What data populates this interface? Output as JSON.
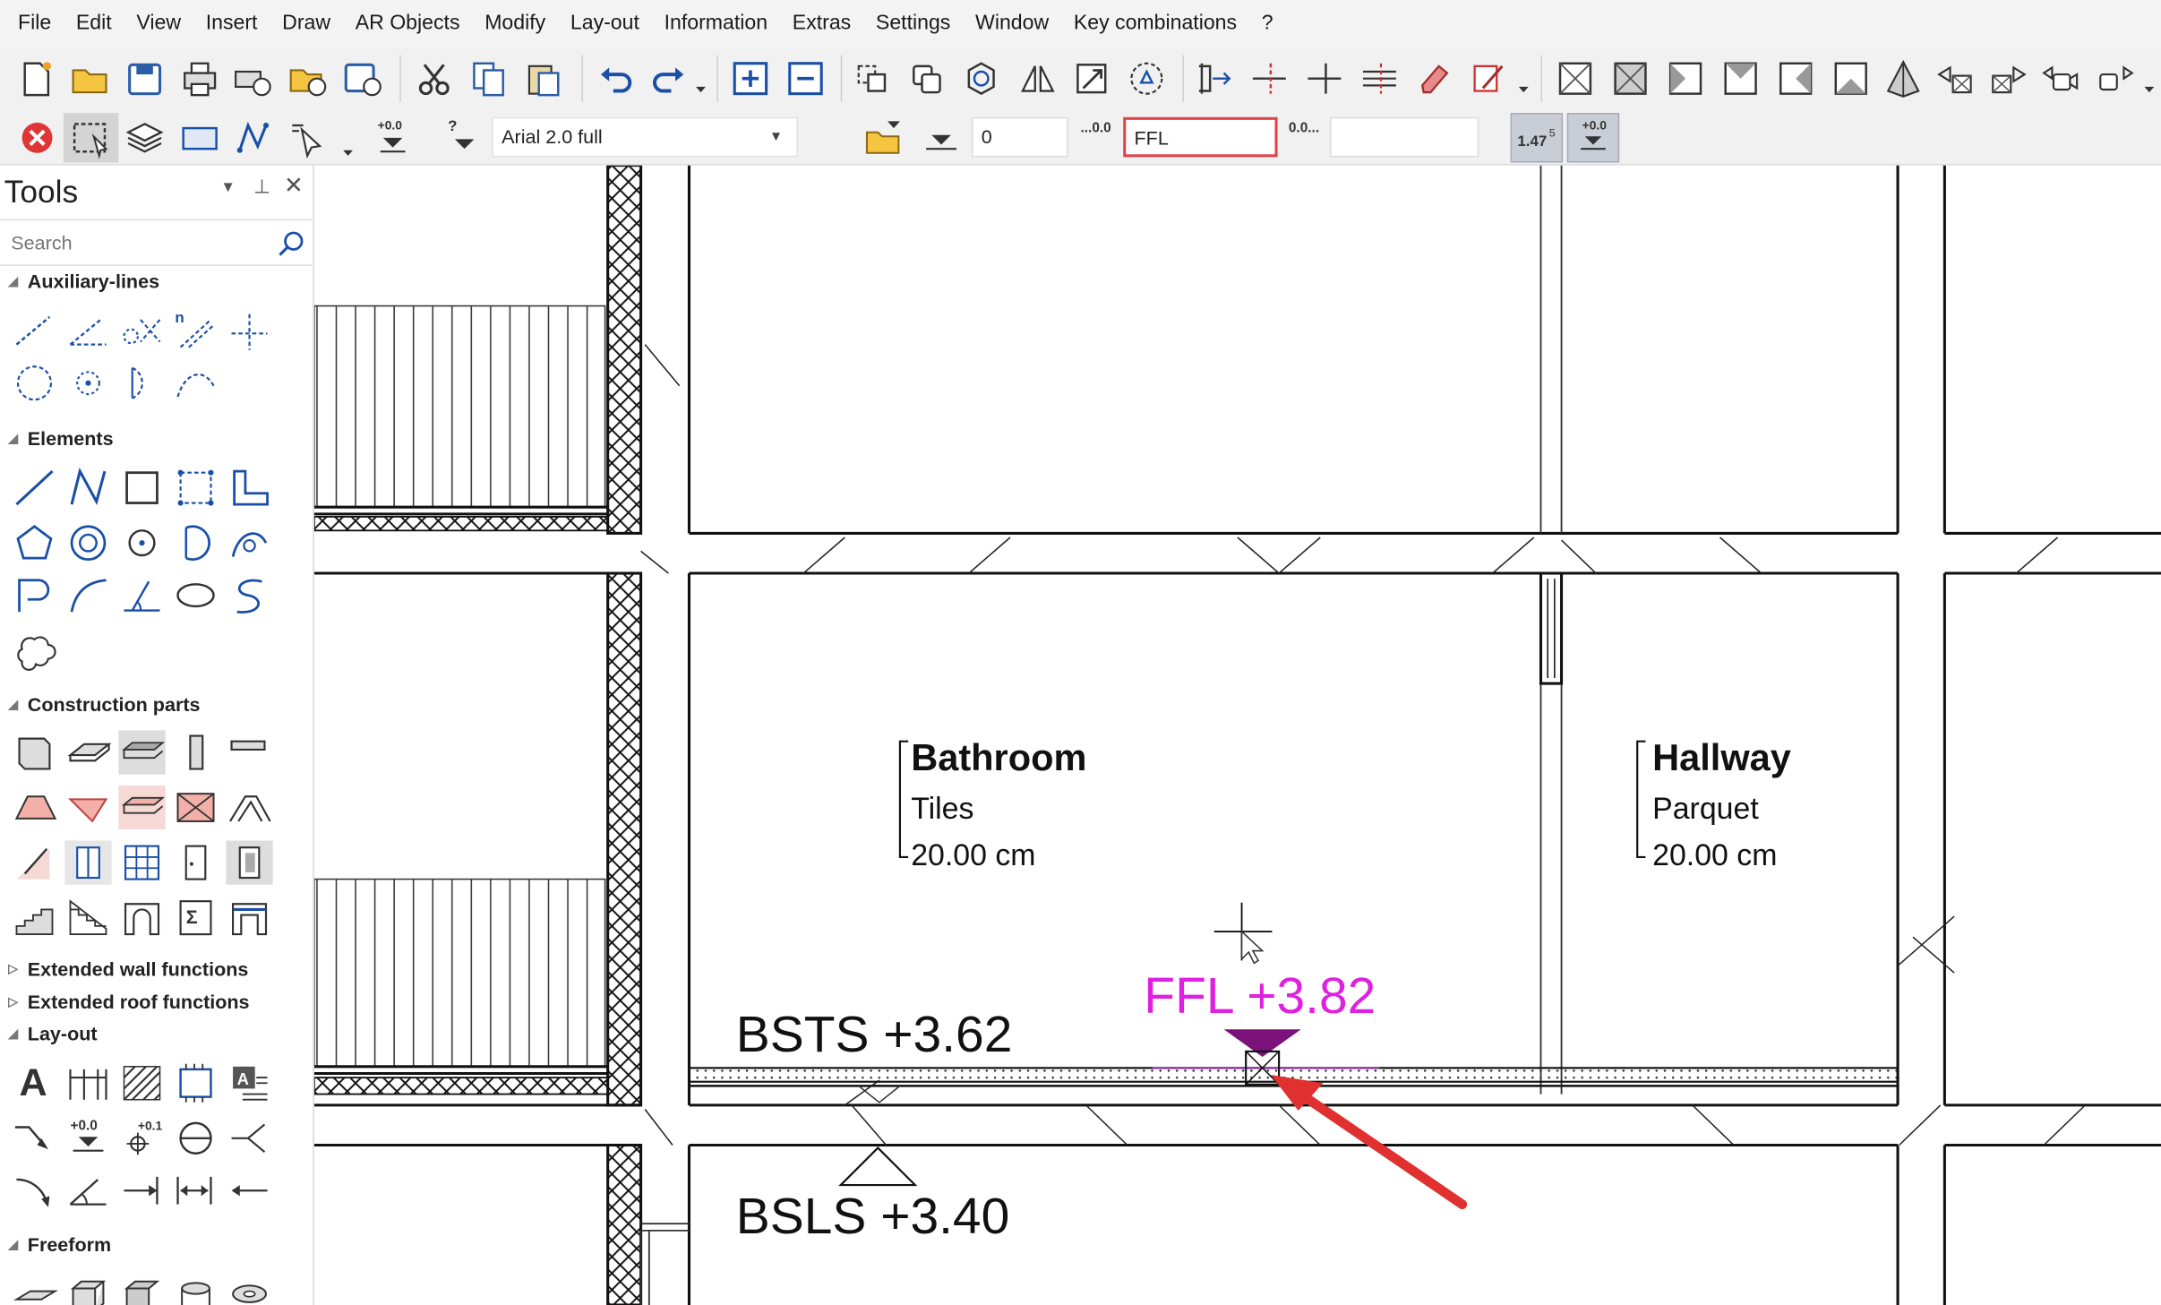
{
  "menu": [
    "File",
    "Edit",
    "View",
    "Insert",
    "Draw",
    "AR Objects",
    "Modify",
    "Lay-out",
    "Information",
    "Extras",
    "Settings",
    "Window",
    "Key combinations",
    "?"
  ],
  "toolbar2": {
    "font_select": "Arial 2.0 full",
    "elevation_value": "0",
    "ffl_field": "FFL",
    "suffix_field": "",
    "decimal_label_a": "...0.0",
    "decimal_label_b": "0.0...",
    "height_display": "1.47",
    "height_superscript": "5",
    "offset_label": "+0.0"
  },
  "tools_panel": {
    "title": "Tools",
    "search_placeholder": "Search",
    "sections": {
      "auxiliary": "Auxiliary-lines",
      "elements": "Elements",
      "construction": "Construction parts",
      "ext_wall": "Extended wall functions",
      "ext_roof": "Extended roof functions",
      "layout": "Lay-out",
      "freeform": "Freeform"
    },
    "layout_icons": {
      "text": "A",
      "offset_a": "+0.0",
      "offset_b": "+0.1"
    }
  },
  "drawing": {
    "rooms": [
      {
        "name": "Bathroom",
        "material": "Tiles",
        "thickness": "20.00 cm"
      },
      {
        "name": "Hallway",
        "material": "Parquet",
        "thickness": "20.00 cm"
      }
    ],
    "labels": {
      "bsts": "BSTS +3.62",
      "ffl": "FFL +3.82",
      "bsls": "BSLS +3.40"
    },
    "colors": {
      "ffl_magenta": "#e020e0",
      "marker_purple": "#7a127a",
      "highlight_red": "#e03030"
    }
  }
}
